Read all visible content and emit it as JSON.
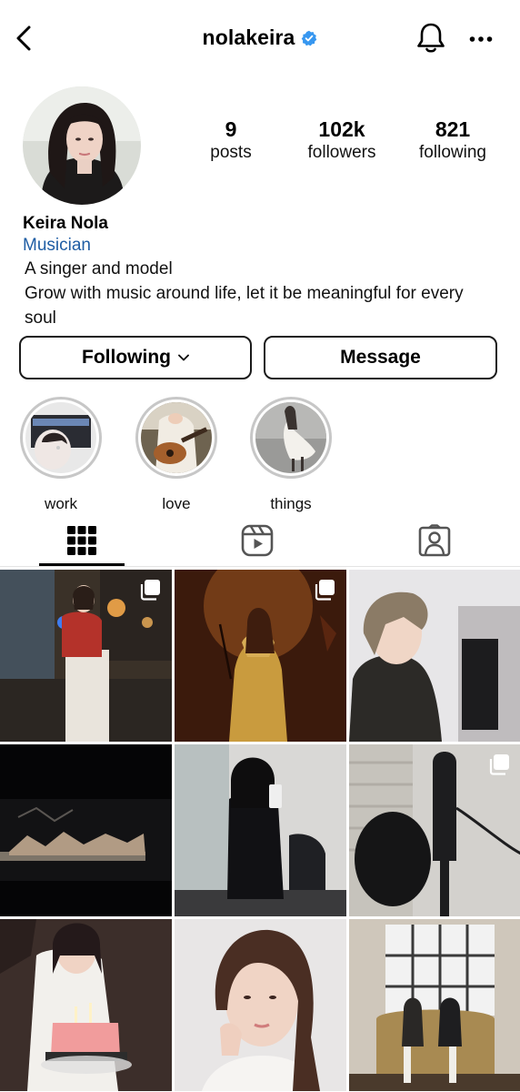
{
  "header": {
    "username": "nolakeira",
    "verified": true,
    "icons": [
      "back-arrow-icon",
      "verified-badge-icon",
      "bell-icon",
      "more-dots-icon"
    ]
  },
  "profile": {
    "stats": [
      {
        "value": "9",
        "label": "posts"
      },
      {
        "value": "102k",
        "label": "followers"
      },
      {
        "value": "821",
        "label": "following"
      }
    ],
    "name": "Keira Nola",
    "category": "Musician",
    "bio": [
      "A singer and model",
      "Grow with music around life, let it be meaningful for every",
      "soul"
    ]
  },
  "actions": {
    "following_label": "Following",
    "message_label": "Message"
  },
  "highlights": [
    {
      "label": "work"
    },
    {
      "label": "love"
    },
    {
      "label": "things"
    }
  ],
  "tabs": [
    {
      "name": "posts-grid",
      "icon": "grid-icon",
      "selected": true
    },
    {
      "name": "reels",
      "icon": "reels-icon",
      "selected": false
    },
    {
      "name": "tagged",
      "icon": "tagged-person-icon",
      "selected": false
    }
  ],
  "posts": [
    {
      "multiple": true
    },
    {
      "multiple": true
    },
    {
      "multiple": false
    },
    {
      "multiple": false
    },
    {
      "multiple": false
    },
    {
      "multiple": true
    },
    {
      "multiple": false
    },
    {
      "multiple": false
    },
    {
      "multiple": false
    }
  ],
  "colors": {
    "link_blue": "#1f5da4",
    "verified_blue": "#3797f0",
    "ring_gray": "#c7c7c7"
  }
}
